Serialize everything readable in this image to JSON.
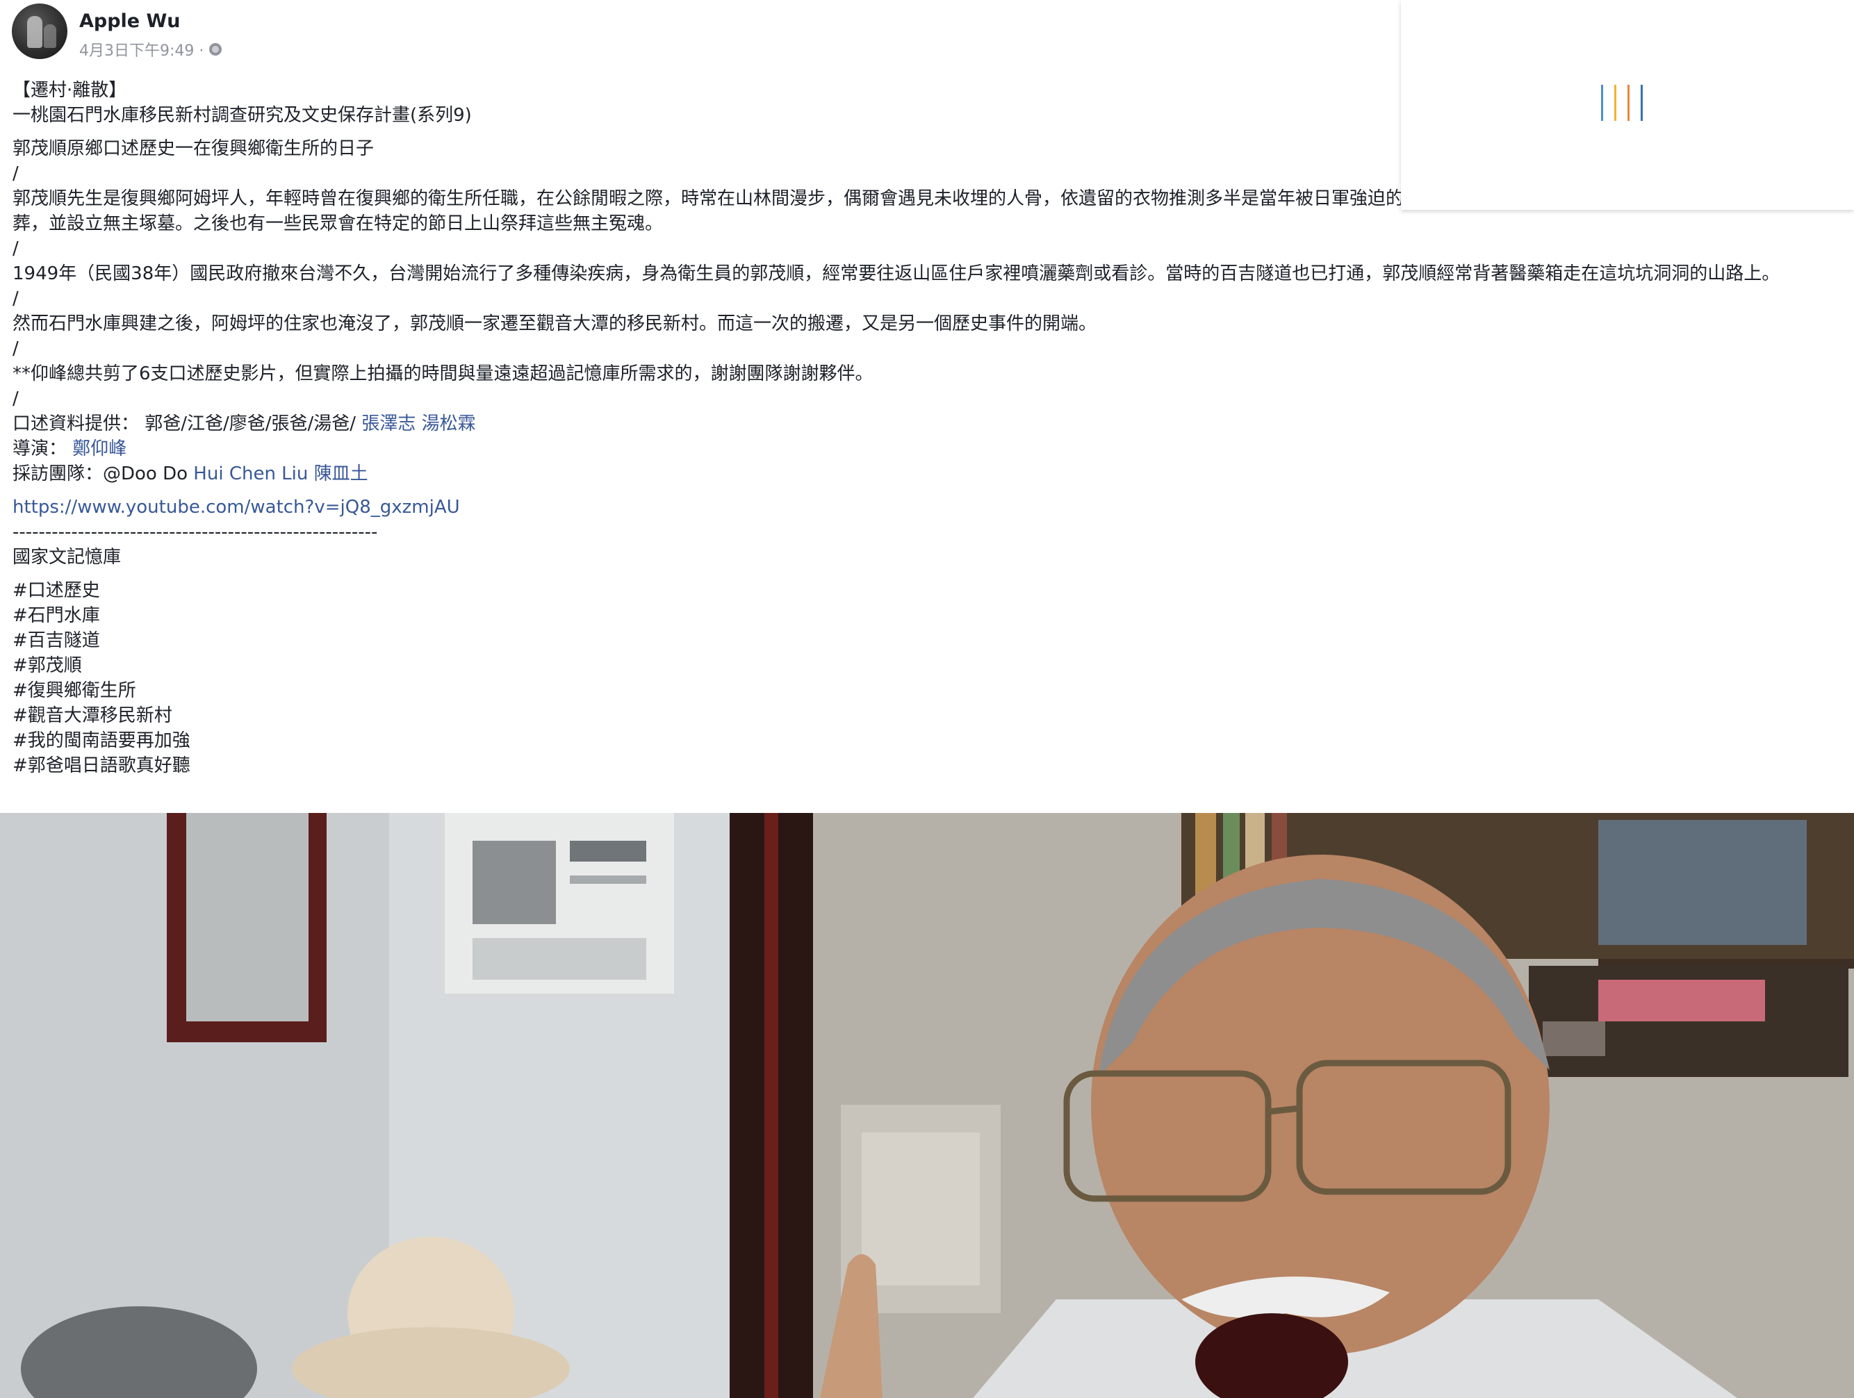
{
  "post": {
    "author": "Apple Wu",
    "timestamp": "4月3日下午9:49 ·",
    "privacy_icon": "globe-icon",
    "lines": {
      "title1": "【遷村·離散】",
      "title2": "一桃園石門水庫移民新村調查研究及文史保存計畫(系列9)",
      "subtitle": "郭茂順原鄉口述歷史一在復興鄉衛生所的日子",
      "sep1": "/",
      "para1": "郭茂順先生是復興鄉阿姆坪人，年輕時曾在復興鄉的衛生所任職，在公餘閒暇之際，時常在山林間漫步，偶爾會遇見未收埋的人骨，依遺留的衣物推測多半是當年被日軍強迫的苦力勞工，郭茂順便將這些骨骸收集起來，在山中埋葬，並設立無主塚墓。之後也有一些民眾會在特定的節日上山祭拜這些無主冤魂。",
      "sep2": "/",
      "para2": "1949年（民國38年）國民政府撤來台灣不久，台灣開始流行了多種傳染疾病，身為衛生員的郭茂順，經常要往返山區住戶家裡噴灑藥劑或看診。當時的百吉隧道也已打通，郭茂順經常背著醫藥箱走在這坑坑洞洞的山路上。",
      "sep3": "/",
      "para3": "然而石門水庫興建之後，阿姆坪的住家也淹沒了，郭茂順一家遷至觀音大潭的移民新村。而這一次的搬遷，又是另一個歷史事件的開端。",
      "sep4": "/",
      "para4": "**仰峰總共剪了6支口述歷史影片，但實際上拍攝的時間與量遠遠超過記憶庫所需求的，謝謝團隊謝謝夥伴。",
      "sep5": "/",
      "credit1_prefix": "口述資料提供： 郭爸/江爸/廖爸/張爸/湯爸/ ",
      "credit1_link1": "張澤志",
      "credit1_link2": "湯松霖",
      "credit2_prefix": "導演： ",
      "credit2_link": "鄭仰峰",
      "credit3_prefix": "採訪團隊：@Doo Do ",
      "credit3_link1": "Hui Chen Liu",
      "credit3_link2": "陳皿土",
      "url": "https://www.youtube.com/watch?v=jQ8_gxzmjAU",
      "dashes": "--------------------------------------------------------",
      "org": "國家文記憶庫"
    },
    "hashtags": [
      "#口述歷史",
      "#石門水庫",
      "#百吉隧道",
      "#郭茂順",
      "#復興鄉衛生所",
      "#觀音大潭移民新村",
      "#我的閩南語要再加強",
      "#郭爸唱日語歌真好聽"
    ]
  },
  "loading_overlay": {
    "bar_colors": [
      "#4a90c8",
      "#f2b233",
      "#e8843f",
      "#3a6fb0"
    ]
  },
  "colors": {
    "text": "#1d2129",
    "link": "#385898",
    "meta": "#90949c"
  }
}
